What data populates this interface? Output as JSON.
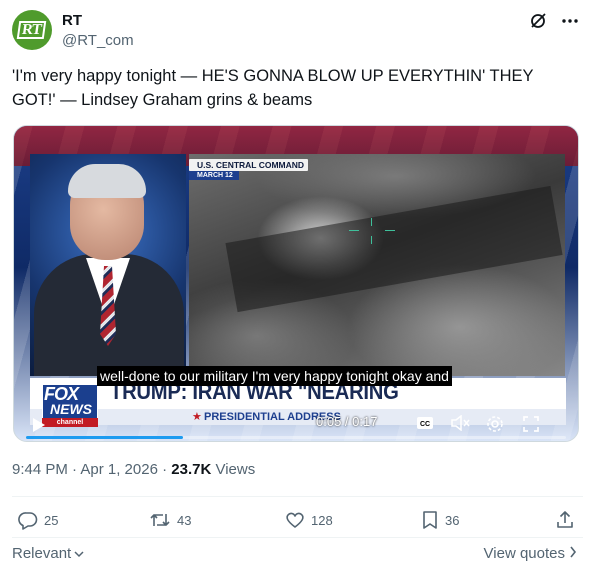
{
  "author": {
    "name": "RT",
    "handle": "@RT_com",
    "avatar_text": "RT",
    "avatar_color": "#4f9b2c"
  },
  "header_icons": [
    "grok-icon",
    "more-icon"
  ],
  "tweet": {
    "text": "'I'm very happy tonight — HE'S GONNA BLOW UP EVERYTHIN' THEY GOT!' — Lindsey Graham grins & beams"
  },
  "video": {
    "overlay_label": "U.S. CENTRAL COMMAND",
    "overlay_date": "MARCH 12",
    "caption": "well-done to our military I'm very happy tonight okay and",
    "headline": "TRUMP: IRAN WAR \"NEARING COMPLETION\"",
    "subline": "PRESIDENTIAL ADDRESS",
    "network_line1": "FOX",
    "network_line2": "NEWS",
    "network_line3": "channel",
    "time": "0:05 / 0:17",
    "progress": 0.29,
    "controls": [
      "play-icon",
      "captions-icon",
      "volume-icon",
      "settings-icon",
      "fullscreen-icon"
    ]
  },
  "meta": {
    "timestamp": "9:44 PM · Apr 1, 2026 · ",
    "views_count": "23.7K",
    "views_label": " Views"
  },
  "actions": {
    "replies": "25",
    "reposts": "43",
    "likes": "128",
    "bookmarks": "36"
  },
  "footer": {
    "relevant": "Relevant",
    "view_quotes": "View quotes"
  },
  "colors": {
    "text": "#0f1419",
    "secondary": "#536471",
    "accent": "#1d9bf0",
    "fox_blue": "#1b3f8e",
    "fox_red": "#c21b23"
  }
}
